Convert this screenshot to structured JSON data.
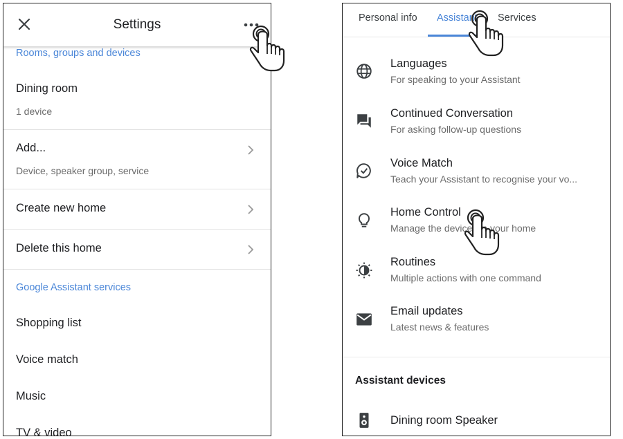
{
  "left_screen": {
    "header": {
      "title": "Settings",
      "close_icon": "close-icon",
      "more_icon": "more-options-icon"
    },
    "rooms_section_label": "Rooms, groups and devices",
    "dining_room": {
      "title": "Dining room",
      "subtitle": "1 device"
    },
    "add": {
      "title": "Add...",
      "subtitle": "Device, speaker group, service"
    },
    "create_home": "Create new home",
    "delete_home": "Delete this home",
    "assistant_section_label": "Google Assistant services",
    "services": [
      "Shopping list",
      "Voice match",
      "Music",
      "TV & video"
    ]
  },
  "right_screen": {
    "tabs": [
      "Personal info",
      "Assistant",
      "Services"
    ],
    "active_tab": "Assistant",
    "items": [
      {
        "title": "Languages",
        "subtitle": "For speaking to your Assistant",
        "icon": "globe-icon"
      },
      {
        "title": "Continued Conversation",
        "subtitle": "For asking follow-up questions",
        "icon": "chat-icon"
      },
      {
        "title": "Voice Match",
        "subtitle": "Teach your Assistant to recognise your vo...",
        "icon": "voice-match-icon"
      },
      {
        "title": "Home Control",
        "subtitle": "Manage the devices in your home",
        "icon": "lightbulb-icon"
      },
      {
        "title": "Routines",
        "subtitle": "Multiple actions with one command",
        "icon": "routines-icon"
      },
      {
        "title": "Email updates",
        "subtitle": "Latest news & features",
        "icon": "email-icon"
      }
    ],
    "devices_section": "Assistant devices",
    "device": {
      "title": "Dining room Speaker",
      "icon": "speaker-icon"
    }
  },
  "colors": {
    "accent": "#4a86d8",
    "text": "#202124",
    "secondary_text": "#6b6b6b",
    "divider": "#e2e2e2"
  }
}
